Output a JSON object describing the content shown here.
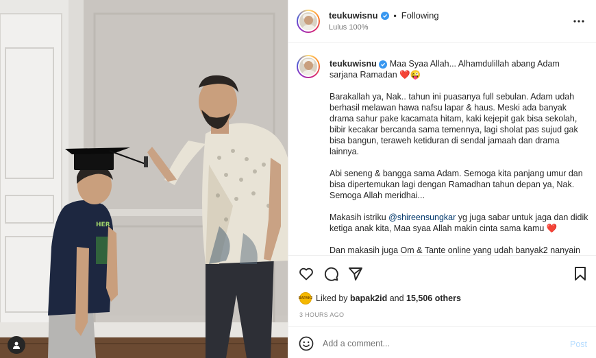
{
  "post": {
    "username": "teukuwisnu",
    "follow_label": "Following",
    "separator": "•",
    "subtitle": "Lulus 100%"
  },
  "caption": {
    "username": "teukuwisnu",
    "first_line": "Maa Syaa Allah... Alhamdulillah abang Adam sarjana Ramadan ❤️😜",
    "paragraphs": [
      "Barakallah ya, Nak.. tahun ini puasanya full sebulan. Adam udah berhasil melawan hawa nafsu lapar & haus. Meski ada banyak drama sahur pake kacamata hitam, kaki kejepit gak bisa sekolah, bibir kecakar bercanda sama temennya, lagi sholat pas sujud gak bisa bangun, teraweh ketiduran di sendal jamaah dan drama lainnya.",
      "Abi seneng & bangga sama Adam. Semoga kita panjang umur dan bisa dipertemukan lagi dengan Ramadhan tahun depan ya, Nak. Semoga Allah meridhai..."
    ],
    "thanks_prefix": "Makasih istriku ",
    "mention": "@shireensungkar",
    "thanks_suffix": " yg juga sabar untuk jaga dan didik ketiga anak kita, Maa syaa Allah makin cinta sama kamu ❤️",
    "last_paragraph": "Dan makasih juga Om & Tante online yang udah banyak2 nanyain"
  },
  "likes": {
    "prefix": "Liked by ",
    "user": "bapak2id",
    "middle": " and ",
    "count": "15,506 others",
    "avatar_text": "BAPAK2"
  },
  "timestamp": "3 HOURS AGO",
  "comment": {
    "placeholder": "Add a comment...",
    "post_label": "Post"
  },
  "icons": {
    "more": "more-horizontal-icon",
    "like": "heart-icon",
    "comment": "comment-icon",
    "share": "share-icon",
    "save": "bookmark-icon",
    "emoji": "emoji-icon",
    "user_tag": "user-icon",
    "verified": "verified-badge-icon"
  },
  "colors": {
    "link": "#00376b",
    "verified": "#3897f0",
    "post_disabled": "#b3dbff",
    "muted": "#737373"
  }
}
